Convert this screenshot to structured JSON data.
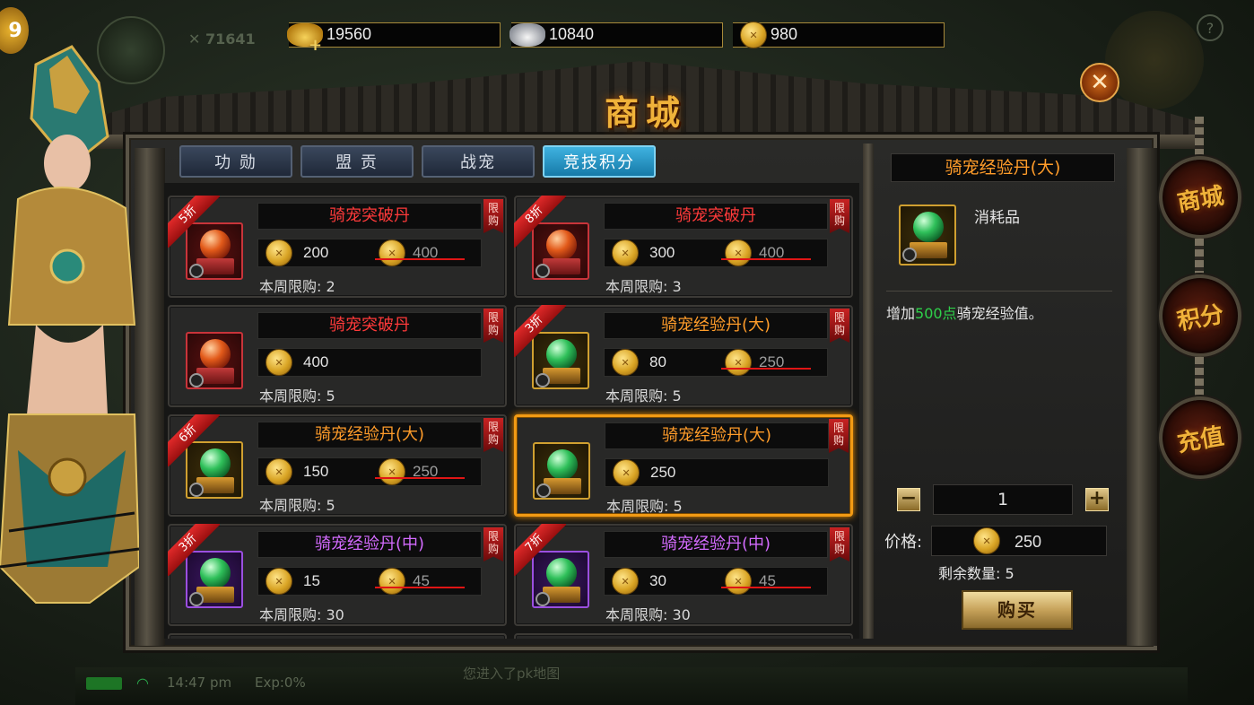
{
  "hud": {
    "level": "9",
    "power": "71641",
    "help": "?",
    "time": "14:47 pm",
    "exp": "Exp:0%",
    "hint": "您进入了pk地图"
  },
  "currencies": [
    {
      "name": "gold-ingot",
      "value": "19560"
    },
    {
      "name": "silver-ingot",
      "value": "10840"
    },
    {
      "name": "coin",
      "value": "980"
    }
  ],
  "window": {
    "title": "商城",
    "close": "✕"
  },
  "tabs": [
    "功 勋",
    "盟 贡",
    "战宠",
    "竞技积分"
  ],
  "active_tab": 3,
  "items": [
    {
      "name": "骑宠突破丹",
      "price": "200",
      "original": "400",
      "limit": "本周限购: 2",
      "discount": "5折",
      "badge": "限购"
    },
    {
      "name": "骑宠突破丹",
      "price": "300",
      "original": "400",
      "limit": "本周限购: 3",
      "discount": "8折",
      "badge": "限购"
    },
    {
      "name": "骑宠突破丹",
      "price": "400",
      "original": "",
      "limit": "本周限购: 5",
      "discount": "",
      "badge": "限购"
    },
    {
      "name": "骑宠经验丹(大)",
      "price": "80",
      "original": "250",
      "limit": "本周限购: 5",
      "discount": "3折",
      "badge": "限购"
    },
    {
      "name": "骑宠经验丹(大)",
      "price": "150",
      "original": "250",
      "limit": "本周限购: 5",
      "discount": "6折",
      "badge": "限购"
    },
    {
      "name": "骑宠经验丹(大)",
      "price": "250",
      "original": "",
      "limit": "本周限购: 5",
      "discount": "",
      "badge": "限购"
    },
    {
      "name": "骑宠经验丹(中)",
      "price": "15",
      "original": "45",
      "limit": "本周限购: 30",
      "discount": "3折",
      "badge": "限购"
    },
    {
      "name": "骑宠经验丹(中)",
      "price": "30",
      "original": "45",
      "limit": "本周限购: 30",
      "discount": "7折",
      "badge": "限购"
    }
  ],
  "detail": {
    "name": "骑宠经验丹(大)",
    "type": "消耗品",
    "desc_prefix": "增加",
    "desc_highlight": "500点",
    "desc_suffix": "骑宠经验值。",
    "quantity": "1",
    "minus": "−",
    "plus": "+",
    "price_label": "价格:",
    "price": "250",
    "remaining": "剩余数量: 5",
    "buy": "购买"
  },
  "side_menu": [
    "商城",
    "积分",
    "充值"
  ],
  "colors": {
    "accent_gold": "#f0b23a",
    "selected_border": "#f29a14",
    "tab_active": "#3fb2e0",
    "highlight_green": "#2ed14a",
    "name_red": "#ff3a3a",
    "name_orange": "#ff9c2a",
    "name_purple": "#d46bff"
  }
}
